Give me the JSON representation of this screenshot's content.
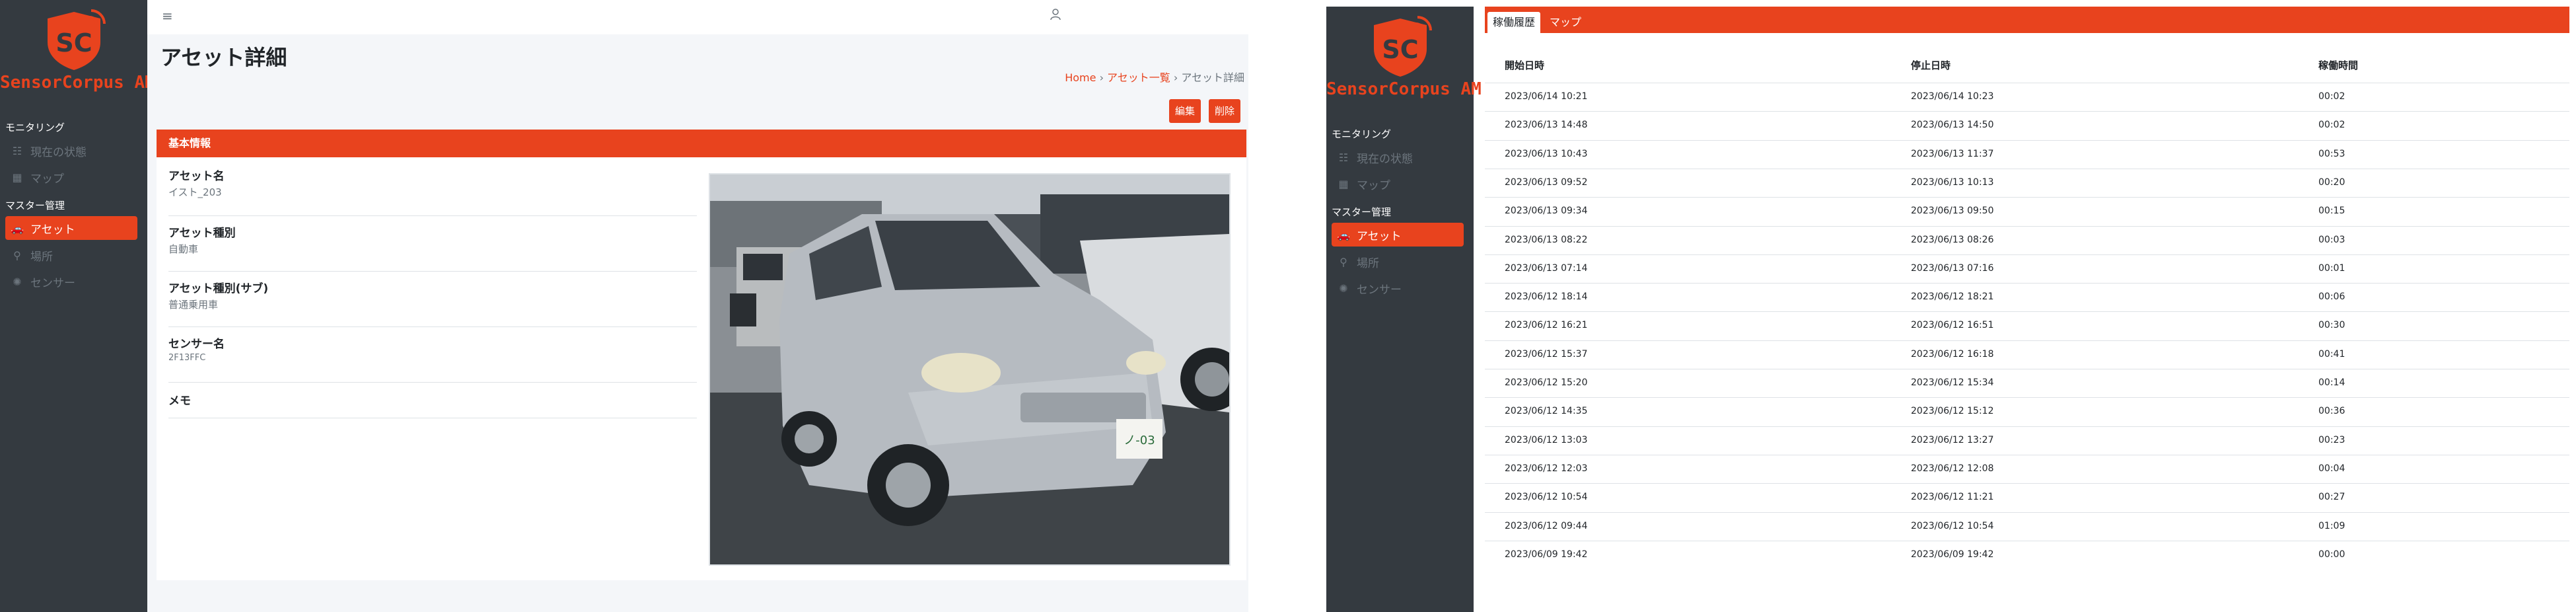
{
  "brand": {
    "name": "SensorCorpus AM",
    "color": "#e8431e"
  },
  "sidebar": {
    "monitoring_header": "モニタリング",
    "master_header": "マスター管理",
    "items": [
      {
        "label": "現在の状態",
        "icon": "list-icon"
      },
      {
        "label": "マップ",
        "icon": "map-icon"
      },
      {
        "label": "アセット",
        "icon": "car-icon",
        "active": true
      },
      {
        "label": "場所",
        "icon": "location-pin-icon"
      },
      {
        "label": "センサー",
        "icon": "sensor-icon"
      }
    ]
  },
  "header": {
    "menu_icon": "hamburger-icon",
    "user_icon": "user-icon"
  },
  "page": {
    "title": "アセット詳細",
    "breadcrumb": {
      "home": "Home",
      "list": "アセット一覧",
      "current": "アセット詳細"
    },
    "edit_label": "編集",
    "delete_label": "削除"
  },
  "card": {
    "header": "基本情報",
    "fields": [
      {
        "label": "アセット名",
        "value": "イスト_203"
      },
      {
        "label": "アセット種別",
        "value": "自動車"
      },
      {
        "label": "アセット種別(サブ)",
        "value": "普通乗用車"
      },
      {
        "label": "センサー名",
        "value": "2F13FFC"
      },
      {
        "label": "メモ",
        "value": ""
      }
    ],
    "photo_alt_plate": "ノ-03"
  },
  "history": {
    "tabs": [
      {
        "label": "稼働履歴",
        "active": true
      },
      {
        "label": "マップ",
        "active": false
      }
    ],
    "columns": [
      "開始日時",
      "停止日時",
      "稼働時間"
    ],
    "rows": [
      [
        "2023/06/14 10:21",
        "2023/06/14 10:23",
        "00:02"
      ],
      [
        "2023/06/13 14:48",
        "2023/06/13 14:50",
        "00:02"
      ],
      [
        "2023/06/13 10:43",
        "2023/06/13 11:37",
        "00:53"
      ],
      [
        "2023/06/13 09:52",
        "2023/06/13 10:13",
        "00:20"
      ],
      [
        "2023/06/13 09:34",
        "2023/06/13 09:50",
        "00:15"
      ],
      [
        "2023/06/13 08:22",
        "2023/06/13 08:26",
        "00:03"
      ],
      [
        "2023/06/13 07:14",
        "2023/06/13 07:16",
        "00:01"
      ],
      [
        "2023/06/12 18:14",
        "2023/06/12 18:21",
        "00:06"
      ],
      [
        "2023/06/12 16:21",
        "2023/06/12 16:51",
        "00:30"
      ],
      [
        "2023/06/12 15:37",
        "2023/06/12 16:18",
        "00:41"
      ],
      [
        "2023/06/12 15:20",
        "2023/06/12 15:34",
        "00:14"
      ],
      [
        "2023/06/12 14:35",
        "2023/06/12 15:12",
        "00:36"
      ],
      [
        "2023/06/12 13:03",
        "2023/06/12 13:27",
        "00:23"
      ],
      [
        "2023/06/12 12:03",
        "2023/06/12 12:08",
        "00:04"
      ],
      [
        "2023/06/12 10:54",
        "2023/06/12 11:21",
        "00:27"
      ],
      [
        "2023/06/12 09:44",
        "2023/06/12 10:54",
        "01:09"
      ],
      [
        "2023/06/09 19:42",
        "2023/06/09 19:42",
        "00:00"
      ]
    ]
  }
}
